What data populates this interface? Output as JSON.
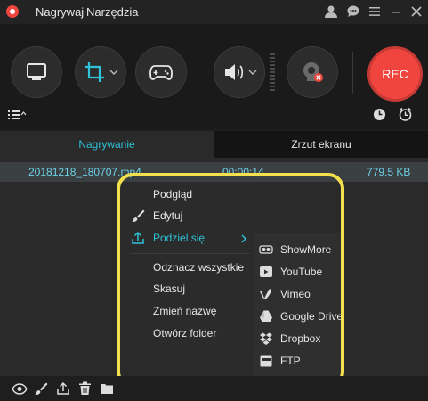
{
  "menu": {
    "record": "Nagrywaj",
    "tools": "Narzędzia"
  },
  "toolbar": {
    "rec_label": "REC"
  },
  "tabs": {
    "recording": "Nagrywanie",
    "screenshot": "Zrzut ekranu"
  },
  "file": {
    "name": "20181218_180707.mp4",
    "duration": "00:00:14",
    "size": "779.5 KB"
  },
  "context_menu": {
    "preview": "Podgląd",
    "edit": "Edytuj",
    "share": "Podziel się",
    "select_all": "Odznacz wszystkie",
    "delete": "Skasuj",
    "rename": "Zmień nazwę",
    "open_folder": "Otwórz folder"
  },
  "share_menu": {
    "showmore": "ShowMore",
    "youtube": "YouTube",
    "vimeo": "Vimeo",
    "google_drive": "Google Drive",
    "dropbox": "Dropbox",
    "ftp": "FTP"
  },
  "colors": {
    "accent": "#2ec3d9",
    "rec": "#f0453e",
    "highlight": "#f4e04d"
  }
}
